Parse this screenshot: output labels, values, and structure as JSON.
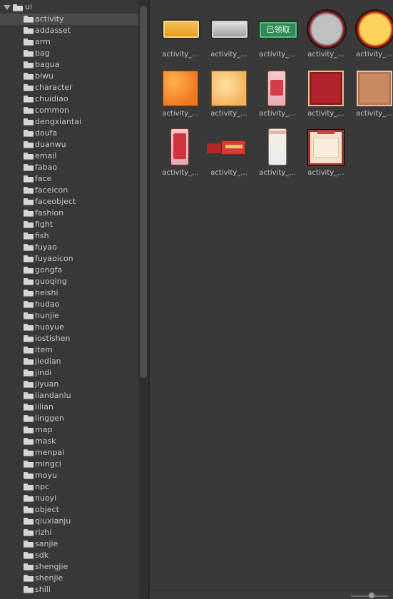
{
  "tree": {
    "root_label": "ui",
    "items": [
      {
        "label": "activity",
        "selected": true
      },
      {
        "label": "addasset"
      },
      {
        "label": "arm"
      },
      {
        "label": "bag"
      },
      {
        "label": "bagua"
      },
      {
        "label": "biwu"
      },
      {
        "label": "character"
      },
      {
        "label": "chuidiao"
      },
      {
        "label": "common"
      },
      {
        "label": "dengxiantai"
      },
      {
        "label": "doufa"
      },
      {
        "label": "duanwu"
      },
      {
        "label": "email"
      },
      {
        "label": "fabao"
      },
      {
        "label": "face"
      },
      {
        "label": "faceicon"
      },
      {
        "label": "faceobject"
      },
      {
        "label": "fashion"
      },
      {
        "label": "fight"
      },
      {
        "label": "fish"
      },
      {
        "label": "fuyao"
      },
      {
        "label": "fuyaoicon"
      },
      {
        "label": "gongfa"
      },
      {
        "label": "guoqing"
      },
      {
        "label": "heishi"
      },
      {
        "label": "hudao"
      },
      {
        "label": "hunjie"
      },
      {
        "label": "huoyue"
      },
      {
        "label": "iostishen"
      },
      {
        "label": "item"
      },
      {
        "label": "jiedian"
      },
      {
        "label": "jindi"
      },
      {
        "label": "jiyuan"
      },
      {
        "label": "liandanlu"
      },
      {
        "label": "lilian"
      },
      {
        "label": "linggen"
      },
      {
        "label": "map"
      },
      {
        "label": "mask"
      },
      {
        "label": "menpai"
      },
      {
        "label": "mingci"
      },
      {
        "label": "moyu"
      },
      {
        "label": "npc"
      },
      {
        "label": "nuoyi"
      },
      {
        "label": "object"
      },
      {
        "label": "qiuxianju"
      },
      {
        "label": "rizhi"
      },
      {
        "label": "sanjie"
      },
      {
        "label": "sdk"
      },
      {
        "label": "shengjie"
      },
      {
        "label": "shenjie"
      },
      {
        "label": "shili"
      }
    ]
  },
  "assets": [
    {
      "label": "activity_...",
      "art": "bar-gold"
    },
    {
      "label": "activity_...",
      "art": "bar-silver"
    },
    {
      "label": "activity_...",
      "art": "badge-green",
      "text": "已领取"
    },
    {
      "label": "activity_...",
      "art": "circle-silver"
    },
    {
      "label": "activity_...",
      "art": "circle-gold"
    },
    {
      "label": "activity_...",
      "art": "sq-orange"
    },
    {
      "label": "activity_...",
      "art": "sq-peach"
    },
    {
      "label": "activity_...",
      "art": "tall-pink"
    },
    {
      "label": "activity_...",
      "art": "sq-red"
    },
    {
      "label": "activity_...",
      "art": "sq-tan"
    },
    {
      "label": "activity_...",
      "art": "tall-red"
    },
    {
      "label": "activity_...",
      "art": "ribbon"
    },
    {
      "label": "activity_...",
      "art": "tall-cream"
    },
    {
      "label": "activity_...",
      "art": "frame"
    }
  ],
  "colors": {
    "panel_bg": "#393939",
    "tree_bg": "#383838",
    "selected_row": "#4a4a4a",
    "text": "#c8c8c8"
  }
}
